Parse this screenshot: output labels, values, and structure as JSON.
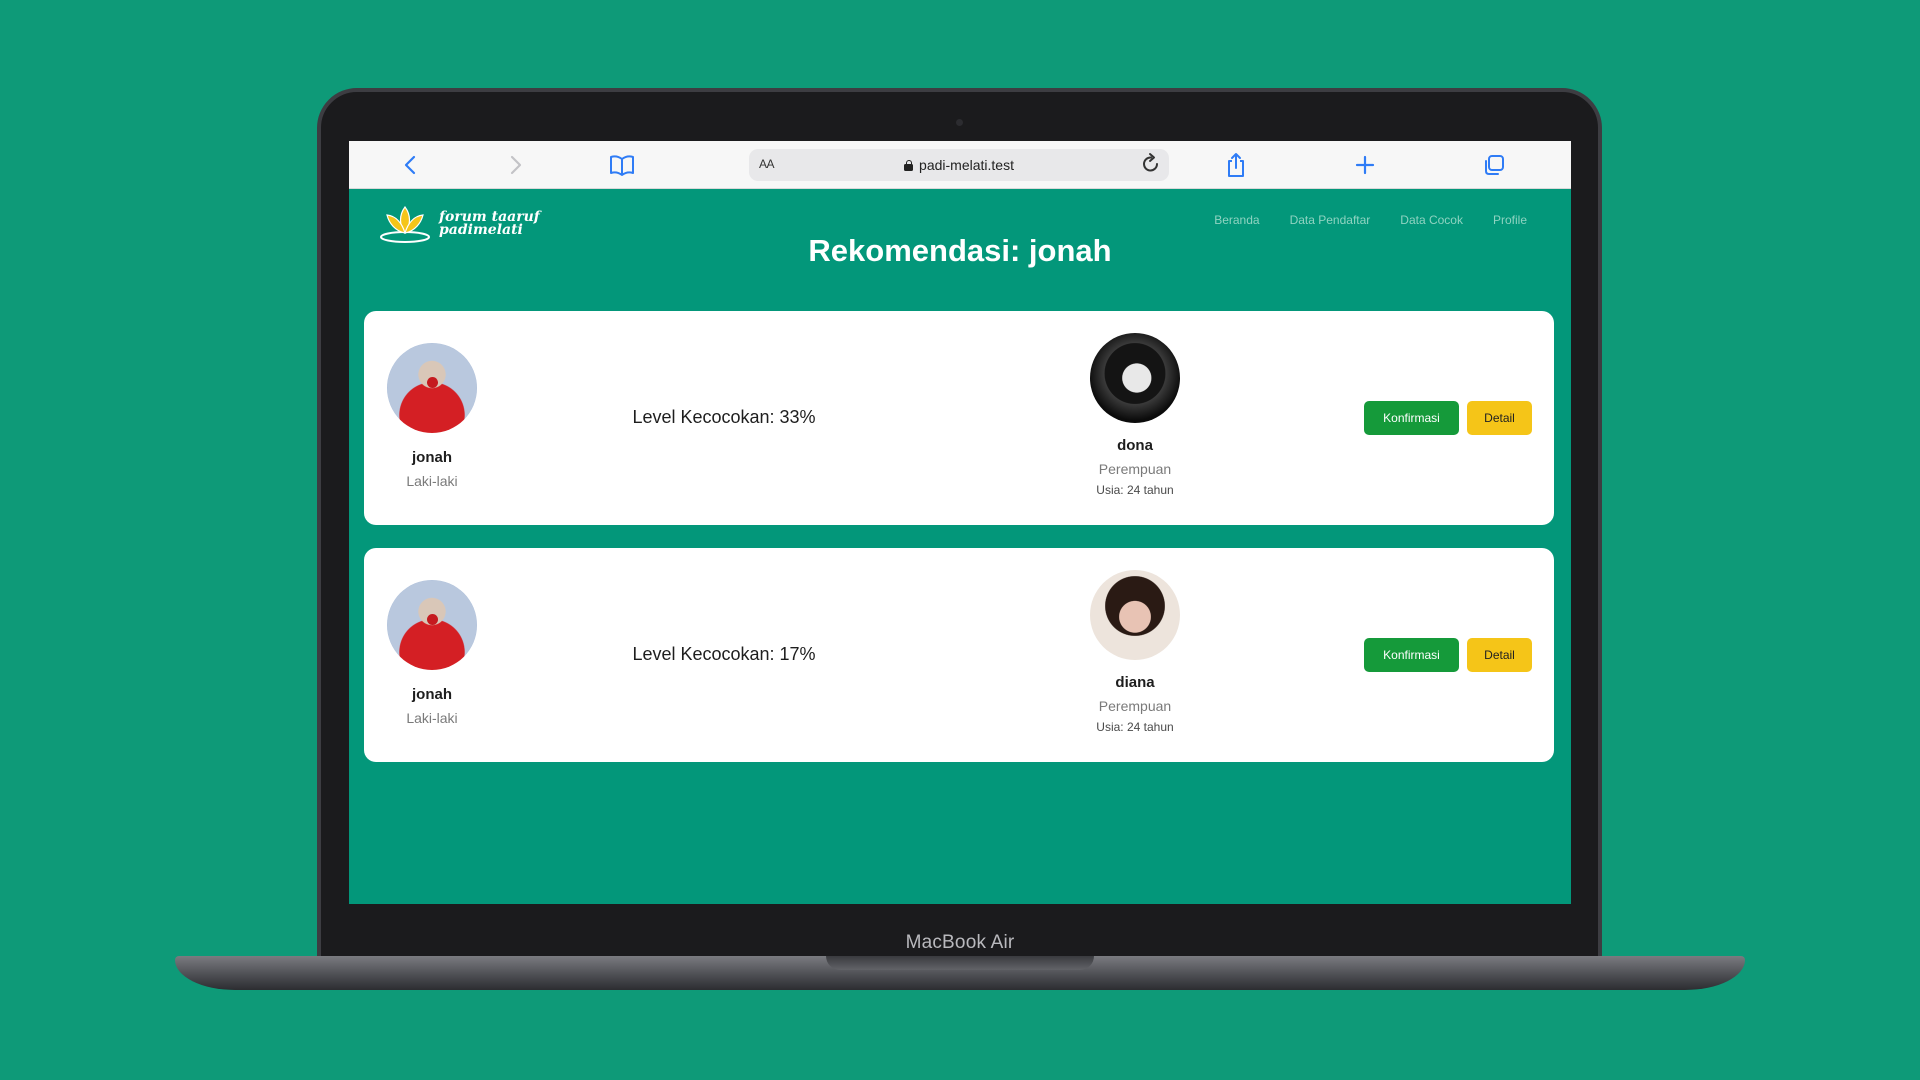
{
  "device": {
    "label": "MacBook Air"
  },
  "browser": {
    "text_size_label": "AA",
    "url": "padi-melati.test",
    "icons": [
      "back-icon",
      "forward-icon",
      "bookmarks-icon",
      "lock-icon",
      "reload-icon",
      "share-icon",
      "new-tab-icon",
      "tabs-icon"
    ]
  },
  "site": {
    "logo_text": "forum taaruf padimelati",
    "nav": [
      "Beranda",
      "Data Pendaftar",
      "Data Cocok",
      "Profile"
    ],
    "title": "Rekomendasi: jonah"
  },
  "recommendations": [
    {
      "user": {
        "name": "jonah",
        "gender": "Laki-laki"
      },
      "match_label": "Level Kecocokan: 33%",
      "match_percent": 33,
      "candidate": {
        "name": "dona",
        "gender": "Perempuan",
        "age": "Usia: 24 tahun"
      },
      "confirm_label": "Konfirmasi",
      "detail_label": "Detail"
    },
    {
      "user": {
        "name": "jonah",
        "gender": "Laki-laki"
      },
      "match_label": "Level Kecocokan: 17%",
      "match_percent": 17,
      "candidate": {
        "name": "diana",
        "gender": "Perempuan",
        "age": "Usia: 24 tahun"
      },
      "confirm_label": "Konfirmasi",
      "detail_label": "Detail"
    }
  ],
  "colors": {
    "brand_green": "#03977a",
    "confirm": "#159a3a",
    "detail": "#f5c518",
    "link": "#2f7cf6"
  }
}
